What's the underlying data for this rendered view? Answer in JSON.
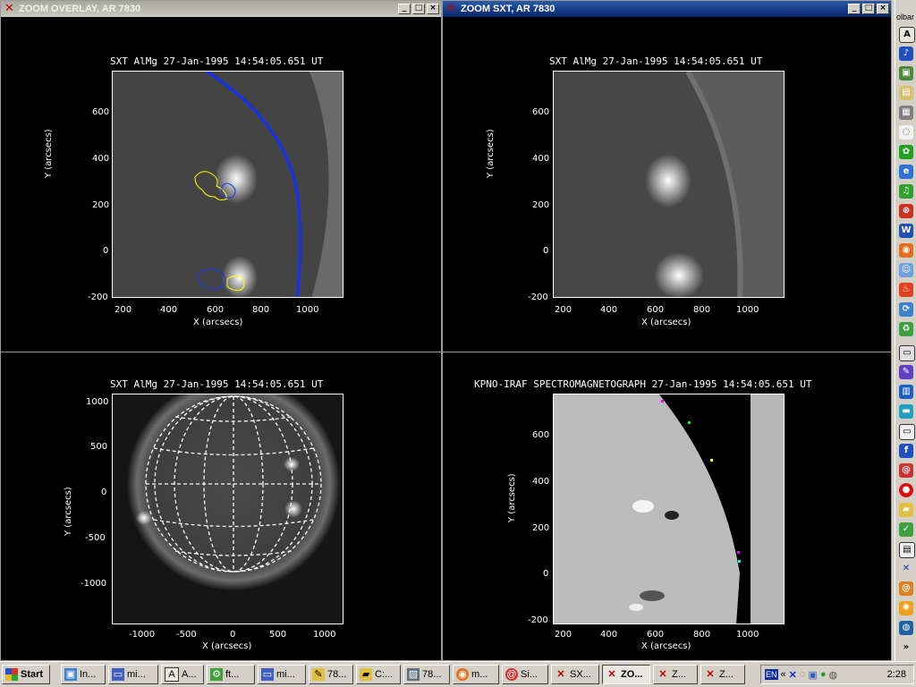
{
  "windows": {
    "overlay": {
      "title": "ZOOM OVERLAY, AR 7830"
    },
    "sxt": {
      "title": "ZOOM SXT, AR 7830"
    }
  },
  "plots": {
    "p1": {
      "title": "SXT AlMg 27-Jan-1995 14:54:05.651 UT",
      "xlabel": "X (arcsecs)",
      "ylabel": "Y (arcsecs)",
      "xticks": [
        "200",
        "400",
        "600",
        "800",
        "1000"
      ],
      "yticks": [
        "600",
        "400",
        "200",
        "0",
        "-200"
      ]
    },
    "p2": {
      "title": "SXT AlMg 27-Jan-1995 14:54:05.651 UT",
      "xlabel": "X (arcsecs)",
      "ylabel": "Y (arcsecs)",
      "xticks": [
        "200",
        "400",
        "600",
        "800",
        "1000"
      ],
      "yticks": [
        "600",
        "400",
        "200",
        "0",
        "-200"
      ]
    },
    "p3": {
      "title": "SXT AlMg 27-Jan-1995 14:54:05.651 UT",
      "xlabel": "X (arcsecs)",
      "ylabel": "Y (arcsecs)",
      "xticks": [
        "-1000",
        "-500",
        "0",
        "500",
        "1000"
      ],
      "yticks": [
        "1000",
        "500",
        "0",
        "-500",
        "-1000"
      ]
    },
    "p4": {
      "title": "KPNO-IRAF SPECTROMAGNETOGRAPH 27-Jan-1995 14:54:05.651 UT",
      "xlabel": "X (arcsecs)",
      "ylabel": "Y (arcsecs)",
      "xticks": [
        "200",
        "400",
        "600",
        "800",
        "1000"
      ],
      "yticks": [
        "600",
        "400",
        "200",
        "0",
        "-200"
      ]
    }
  },
  "taskbar": {
    "start": "Start",
    "tasks": [
      "In...",
      "mi...",
      "A...",
      "ft...",
      "mi...",
      "78...",
      "C:...",
      "78...",
      "m...",
      "Si...",
      "SX...",
      "ZO...",
      "Z...",
      "Z..."
    ],
    "tray_lang": "EN",
    "clock": "2:28"
  },
  "quick_toolbar": {
    "label": "olbar"
  },
  "colors": {
    "title_active": "#0a246a",
    "title_inactive": "#a7a79f",
    "limb": "#1030ff",
    "contour_pos": "#ffff00",
    "contour_neg": "#2030ff"
  }
}
